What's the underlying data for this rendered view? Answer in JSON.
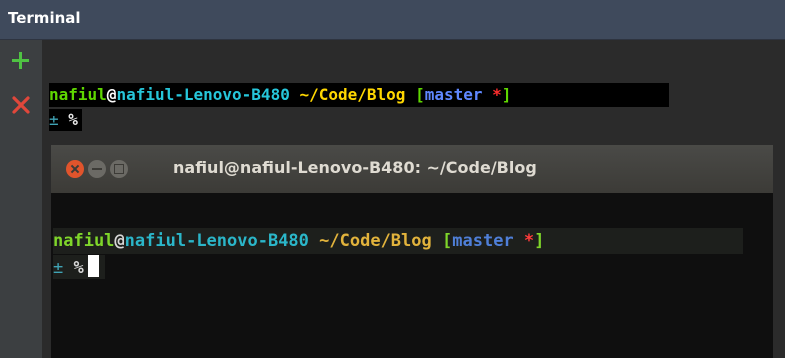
{
  "panel": {
    "title": "Terminal"
  },
  "toolbar": {
    "add_icon": "plus-icon",
    "close_icon": "close-icon"
  },
  "ide_terminal": {
    "user": "nafiul",
    "at": "@",
    "host": "nafiul-Lenovo-B480",
    "path": "~/Code/Blog",
    "bracket_open": "[",
    "branch": "master",
    "dirty": "*",
    "bracket_close": "]",
    "prompt_plusminus": "±",
    "prompt_symbol": "%"
  },
  "gnome_terminal": {
    "title": "nafiul@nafiul-Lenovo-B480: ~/Code/Blog",
    "user": "nafiul",
    "at": "@",
    "host": "nafiul-Lenovo-B480",
    "path": "~/Code/Blog",
    "bracket_open": "[",
    "branch": "master",
    "dirty": "*",
    "bracket_close": "]",
    "prompt_plusminus": "±",
    "prompt_symbol": "%"
  },
  "colors": {
    "user": "#5fd700",
    "host": "#26c6da",
    "path": "#ffd700",
    "branch": "#5f87ff",
    "dirty": "#ff2d2d"
  }
}
